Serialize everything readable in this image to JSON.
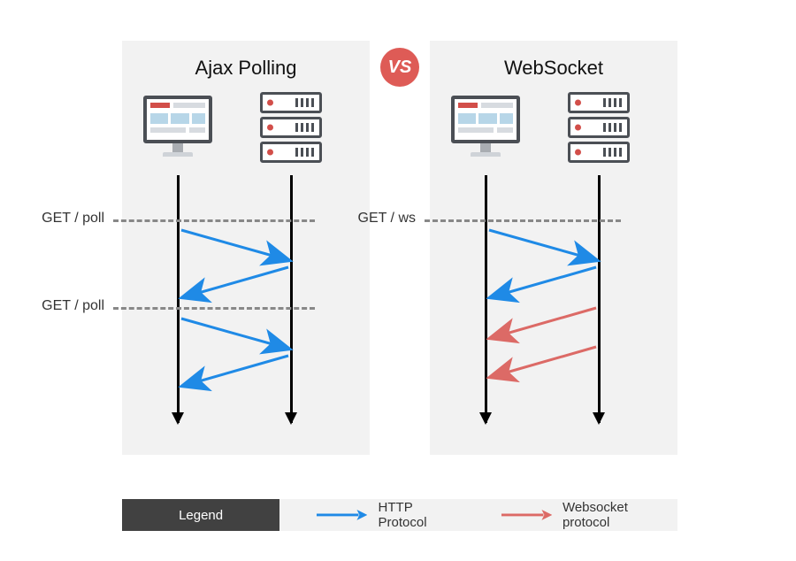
{
  "panels": {
    "left": {
      "title": "Ajax Polling",
      "events": [
        "GET / poll",
        "GET / poll"
      ]
    },
    "right": {
      "title": "WebSocket",
      "events": [
        "GET / ws"
      ]
    }
  },
  "vs_label": "VS",
  "legend": {
    "title": "Legend",
    "items": [
      {
        "color": "#1f8ae6",
        "label": "HTTP Protocol"
      },
      {
        "color": "#dc6a66",
        "label": "Websocket protocol"
      }
    ]
  },
  "colors": {
    "http": "#1f8ae6",
    "ws": "#dc6a66"
  },
  "chart_data": {
    "type": "sequence-diagram",
    "participants": [
      "client",
      "server"
    ],
    "diagrams": [
      {
        "name": "Ajax Polling",
        "messages": [
          {
            "from": "client",
            "to": "server",
            "label": "GET / poll",
            "protocol": "http"
          },
          {
            "from": "server",
            "to": "client",
            "protocol": "http"
          },
          {
            "from": "client",
            "to": "server",
            "label": "GET / poll",
            "protocol": "http"
          },
          {
            "from": "server",
            "to": "client",
            "protocol": "http"
          }
        ]
      },
      {
        "name": "WebSocket",
        "messages": [
          {
            "from": "client",
            "to": "server",
            "label": "GET / ws",
            "protocol": "http"
          },
          {
            "from": "server",
            "to": "client",
            "protocol": "http"
          },
          {
            "from": "server",
            "to": "client",
            "protocol": "ws"
          },
          {
            "from": "server",
            "to": "client",
            "protocol": "ws"
          }
        ]
      }
    ]
  }
}
